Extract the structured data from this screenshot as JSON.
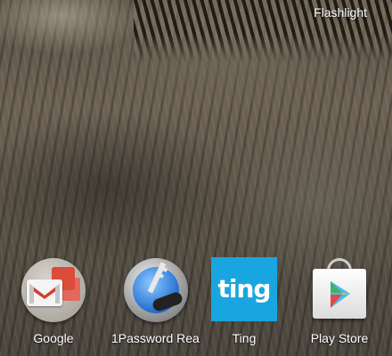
{
  "shortcut": {
    "label": "Flashlight"
  },
  "dock": {
    "apps": [
      {
        "label": "Google",
        "icon": "google-folder-icon"
      },
      {
        "label": "1Password Rea..",
        "icon": "1password-icon"
      },
      {
        "label": "Ting",
        "icon": "ting-icon",
        "icon_text": "ting",
        "color": "#19a6e0"
      },
      {
        "label": "Play Store",
        "icon": "play-store-icon"
      }
    ]
  }
}
